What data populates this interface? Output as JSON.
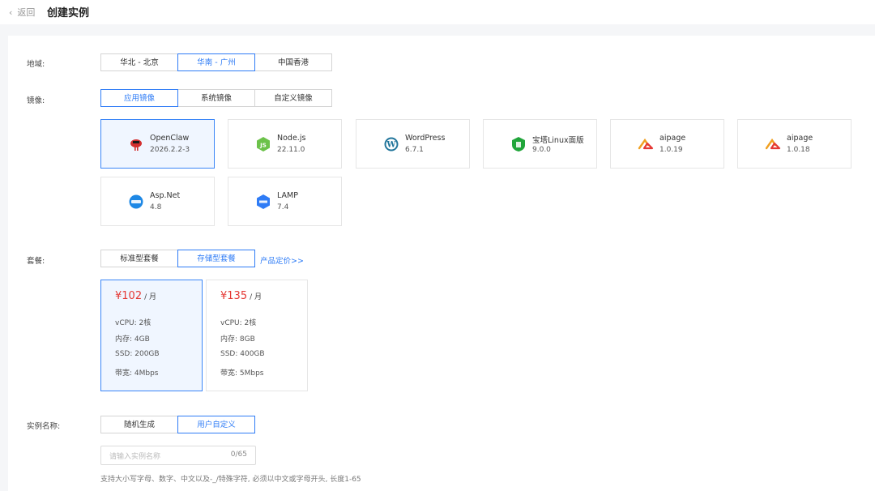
{
  "header": {
    "back_label": "返回",
    "title": "创建实例"
  },
  "region": {
    "label": "地域:",
    "options": [
      "华北 - 北京",
      "华南 - 广州",
      "中国香港"
    ],
    "selected": "华南 - 广州"
  },
  "image": {
    "label": "镜像:",
    "tabs": [
      "应用镜像",
      "系统镜像",
      "自定义镜像"
    ],
    "selected_tab": "应用镜像",
    "cards": [
      {
        "name": "OpenClaw",
        "version": "2026.2.2-3",
        "icon": "openclaw-icon",
        "selected": true
      },
      {
        "name": "Node.js",
        "version": "22.11.0",
        "icon": "nodejs-icon"
      },
      {
        "name": "WordPress",
        "version": "6.7.1",
        "icon": "wordpress-icon"
      },
      {
        "name": "宝塔Linux面版",
        "version": "9.0.0",
        "icon": "baota-icon"
      },
      {
        "name": "aipage",
        "version": "1.0.19",
        "icon": "aipage-icon"
      },
      {
        "name": "aipage",
        "version": "1.0.18",
        "icon": "aipage-icon"
      },
      {
        "name": "Asp.Net",
        "version": "4.8",
        "icon": "aspnet-icon"
      },
      {
        "name": "LAMP",
        "version": "7.4",
        "icon": "lamp-icon"
      }
    ]
  },
  "package": {
    "label": "套餐:",
    "tabs": [
      "标准型套餐",
      "存储型套餐"
    ],
    "selected_tab": "存储型套餐",
    "pricing_link": "产品定价>>",
    "plans": [
      {
        "price": "¥102",
        "unit": "/ 月",
        "vcpu": "vCPU: 2核",
        "memory": "内存: 4GB",
        "ssd": "SSD: 200GB",
        "bandwidth": "带宽: 4Mbps",
        "selected": true
      },
      {
        "price": "¥135",
        "unit": "/ 月",
        "vcpu": "vCPU: 2核",
        "memory": "内存: 8GB",
        "ssd": "SSD: 400GB",
        "bandwidth": "带宽: 5Mbps"
      }
    ]
  },
  "instance_name": {
    "label": "实例名称:",
    "options": [
      "随机生成",
      "用户自定义"
    ],
    "selected": "用户自定义",
    "placeholder": "请输入实例名称",
    "counter": "0/65",
    "hint": "支持大小写字母、数字、中文以及-_/特殊字符, 必须以中文或字母开头, 长度1-65"
  },
  "colors": {
    "accent": "#2f7cf6",
    "price": "#e53935",
    "selected_bg": "#f0f6ff"
  }
}
